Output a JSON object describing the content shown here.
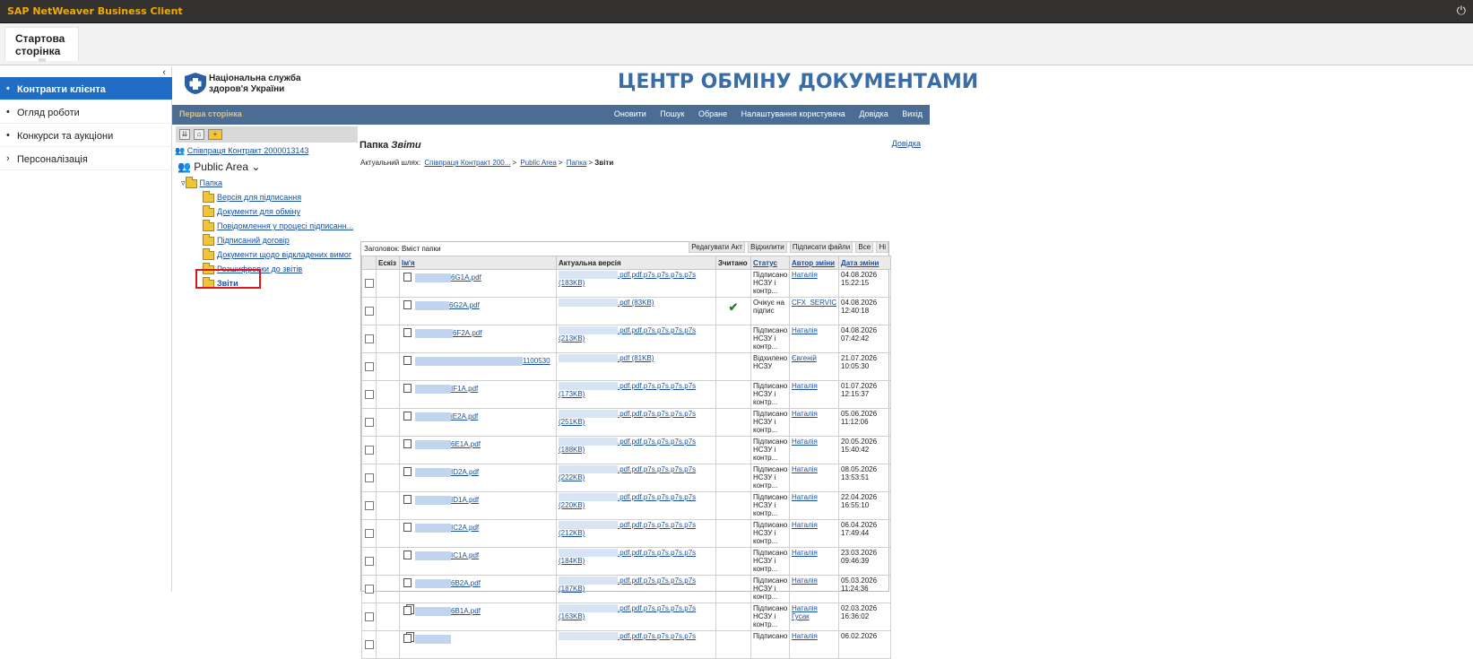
{
  "app": {
    "title": "SAP NetWeaver Business Client",
    "power_icon": "power-icon"
  },
  "tab": {
    "label": "Стартова сторінка"
  },
  "nav": {
    "collapse": "‹",
    "items": [
      {
        "label": "Контракти клієнта",
        "active": true
      },
      {
        "label": "Огляд роботи"
      },
      {
        "label": "Конкурси та аукціони"
      },
      {
        "label": "Персоналізація"
      }
    ]
  },
  "header": {
    "org_line1": "Національна служба",
    "org_line2": "здоров'я України",
    "title": "ЦЕНТР ОБМІНУ ДОКУМЕНТАМИ"
  },
  "menubar": {
    "first_page": "Перша сторінка",
    "links": [
      "Оновити",
      "Пошук",
      "Обране",
      "Налаштування користувача",
      "Довідка",
      "Вихід"
    ]
  },
  "tree": {
    "contract": "Співпраця Контракт 2000013143",
    "area": "Public Area",
    "root": "Папка",
    "folders": [
      "Версія для підписання",
      "Документи для обміну",
      "Повідомлення у процесі підписанн...",
      "Підписаний договір",
      "Документи щодо відкладених вимог",
      "Розшифровки до звітів",
      "Звіти"
    ]
  },
  "content": {
    "folder_prefix": "Папка",
    "folder_name": "Звіти",
    "help": "Довідка",
    "path_label": "Актуальний шлях:",
    "path_items": [
      "Співпраця Контракт 200...",
      "Public Area",
      "Папка"
    ],
    "path_current": "Звіти",
    "table_header": "Заголовок: Вміст папки",
    "actions": [
      "Редагувати Акт",
      "Відхилити",
      "Підписати файли",
      "Все",
      "Ні"
    ],
    "columns": [
      "",
      "Ескіз",
      "Ім'я",
      "Актуальна версія",
      "Зчитано",
      "Статус",
      "Автор зміни",
      "Дата зміни"
    ],
    "rows": [
      {
        "name": "6G1A.pdf",
        "version": ".pdf.pdf.p7s.p7s.p7s.p7s",
        "size": "(183KB)",
        "read": "",
        "status": "Підписано НСЗУ і контр...",
        "author": "Наталія",
        "date": "04.08.2026",
        "time": "15:22:15"
      },
      {
        "name": "6G2A.pdf",
        "version": ".pdf (83KB)",
        "size": "",
        "read": "✔",
        "status": "Очікує на підпис",
        "author": "CFX_SERVIC",
        "date": "04.08.2026",
        "time": "12:40:18"
      },
      {
        "name": "6F2A.pdf",
        "version": ".pdf.pdf.p7s.p7s.p7s.p7s",
        "size": "(213KB)",
        "read": "",
        "status": "Підписано НСЗУ і контр...",
        "author": "Наталія",
        "date": "04.08.2026",
        "time": "07:42:42"
      },
      {
        "name": "1100530",
        "version": ".pdf (81KB)",
        "size": "",
        "read": "",
        "status": "Відхилено НСЗУ",
        "author": "Євгеній",
        "date": "21.07.2026",
        "time": "10:05:30"
      },
      {
        "name": "IF1A.pdf",
        "version": ".pdf.pdf.p7s.p7s.p7s.p7s",
        "size": "(173KB)",
        "read": "",
        "status": "Підписано НСЗУ і контр...",
        "author": "Наталія",
        "date": "01.07.2026",
        "time": "12:15:37"
      },
      {
        "name": "iE2A.pdf",
        "version": ".pdf.pdf.p7s.p7s.p7s.p7s",
        "size": "(251KB)",
        "read": "",
        "status": "Підписано НСЗУ і контр...",
        "author": "Наталія",
        "date": "05.06.2026",
        "time": "11:12:06"
      },
      {
        "name": "6E1A.pdf",
        "version": ".pdf.pdf.p7s.p7s.p7s.p7s",
        "size": "(188KB)",
        "read": "",
        "status": "Підписано НСЗУ і контр...",
        "author": "Наталія",
        "date": "20.05.2026",
        "time": "15:40:42"
      },
      {
        "name": "ID2A.pdf",
        "version": ".pdf.pdf.p7s.p7s.p7s.p7s",
        "size": "(222KB)",
        "read": "",
        "status": "Підписано НСЗУ і контр...",
        "author": "Наталія",
        "date": "08.05.2026",
        "time": "13:53:51"
      },
      {
        "name": "ID1A.pdf",
        "version": ".pdf.pdf.p7s.p7s.p7s.p7s",
        "size": "(220KB)",
        "read": "",
        "status": "Підписано НСЗУ і контр...",
        "author": "Наталія",
        "date": "22.04.2026",
        "time": "16:55:10"
      },
      {
        "name": "IC2A.pdf",
        "version": ".pdf.pdf.p7s.p7s.p7s.p7s",
        "size": "(212KB)",
        "read": "",
        "status": "Підписано НСЗУ і контр...",
        "author": "Наталія",
        "date": "06.04.2026",
        "time": "17:49:44"
      },
      {
        "name": "IC1A.pdf",
        "version": ".pdf.pdf.p7s.p7s.p7s.p7s",
        "size": "(184KB)",
        "read": "",
        "status": "Підписано НСЗУ і контр...",
        "author": "Наталія",
        "date": "23.03.2026",
        "time": "09:46:39"
      },
      {
        "name": "6B2A.pdf",
        "version": ".pdf.pdf.p7s.p7s.p7s.p7s",
        "size": "(187KB)",
        "read": "",
        "status": "Підписано НСЗУ і контр...",
        "author": "Наталія",
        "date": "05.03.2026",
        "time": "11:24:36"
      },
      {
        "name": "6B1A.pdf",
        "version": ".pdf.pdf.p7s.p7s.p7s.p7s",
        "size": "(163KB)",
        "read": "",
        "status": "Підписано НСЗУ і контр...",
        "author": "Наталія Гусак",
        "date": "02.03.2026",
        "time": "16:36:02"
      },
      {
        "name": "",
        "version": ".pdf.pdf.p7s.p7s.p7s.p7s",
        "size": "",
        "read": "",
        "status": "Підписано",
        "author": "Наталія",
        "date": "06.02.2026",
        "time": ""
      }
    ]
  }
}
